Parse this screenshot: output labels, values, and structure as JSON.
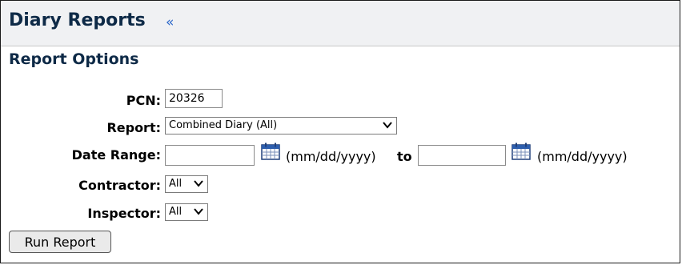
{
  "header": {
    "title": "Diary Reports",
    "collapse_symbol": "«"
  },
  "section": {
    "title": "Report Options"
  },
  "form": {
    "pcn": {
      "label": "PCN:",
      "value": "20326"
    },
    "report": {
      "label": "Report:",
      "selected": "Combined Diary (All)"
    },
    "date_range": {
      "label": "Date Range:",
      "from_value": "",
      "format_hint": "(mm/dd/yyyy)",
      "to_label": "to",
      "to_value": "",
      "format_hint_2": "(mm/dd/yyyy)"
    },
    "contractor": {
      "label": "Contractor:",
      "selected": "All"
    },
    "inspector": {
      "label": "Inspector:",
      "selected": "All"
    }
  },
  "actions": {
    "run_label": "Run Report"
  },
  "icons": {
    "calendar": "calendar-icon",
    "dropdown": "chevron-down-icon"
  }
}
